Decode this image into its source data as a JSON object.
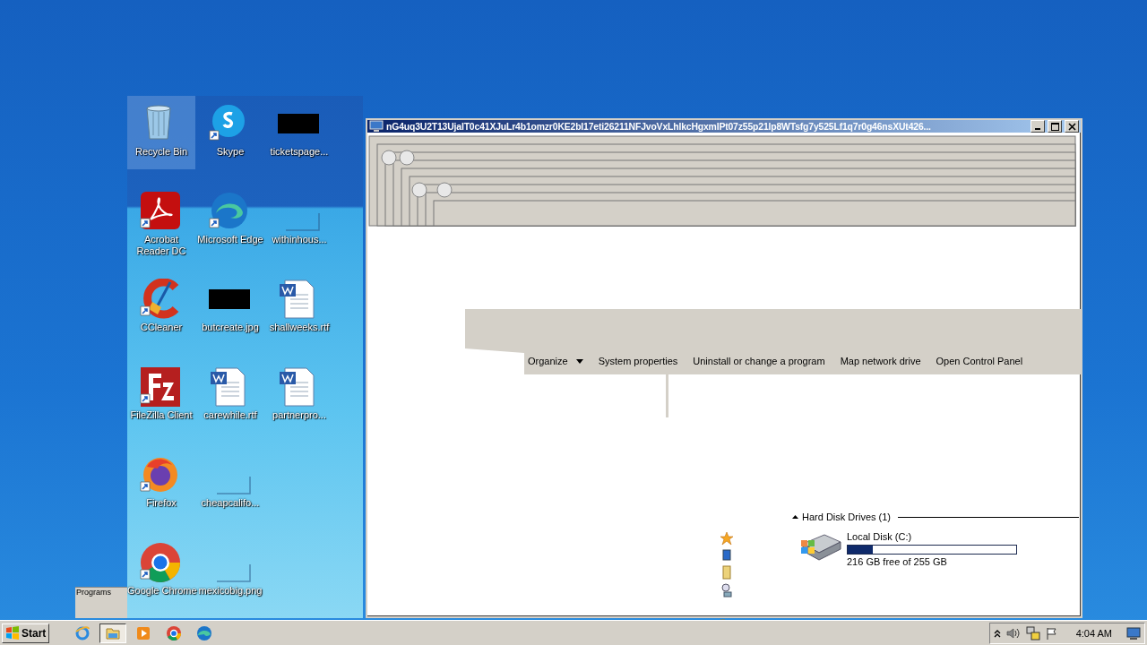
{
  "desktop_icons": [
    {
      "label": "Recycle Bin",
      "kind": "trash",
      "shortcut": false,
      "selected": true
    },
    {
      "label": "Skype",
      "kind": "chat",
      "shortcut": true,
      "selected": false
    },
    {
      "label": "ticketspage...",
      "kind": "redacted",
      "shortcut": false,
      "selected": false
    },
    {
      "label": "Acrobat Reader DC",
      "kind": "pdf",
      "shortcut": true,
      "selected": false
    },
    {
      "label": "Microsoft Edge",
      "kind": "edge",
      "shortcut": true,
      "selected": false
    },
    {
      "label": "withinhous...",
      "kind": "blank",
      "shortcut": false,
      "selected": false
    },
    {
      "label": "CCleaner",
      "kind": "broom",
      "shortcut": true,
      "selected": false
    },
    {
      "label": "butcreate.jpg",
      "kind": "redacted",
      "shortcut": false,
      "selected": false
    },
    {
      "label": "shallweeks.rtf",
      "kind": "document",
      "shortcut": false,
      "selected": false
    },
    {
      "label": "FileZilla Client",
      "kind": "filezilla",
      "shortcut": true,
      "selected": false
    },
    {
      "label": "carewhile.rtf",
      "kind": "document",
      "shortcut": false,
      "selected": false
    },
    {
      "label": "partnerpro...",
      "kind": "document",
      "shortcut": false,
      "selected": false
    },
    {
      "label": "Firefox",
      "kind": "firefox",
      "shortcut": true,
      "selected": false
    },
    {
      "label": "cheapcalifo...",
      "kind": "blank",
      "shortcut": false,
      "selected": false
    },
    {
      "kind": "empty"
    },
    {
      "label": "Google Chrome",
      "kind": "chrome",
      "shortcut": true,
      "selected": false
    },
    {
      "label": "mexicobig.png",
      "kind": "blank",
      "shortcut": false,
      "selected": false
    }
  ],
  "desktop_fragment": "Programs",
  "window": {
    "title": "nG4uq3U2T13UjaIT0c41XJuLr4b1omzr0KE2bI17eti26211NFJvoVxLhIkcHgxmIPt07z55p21lp8WTsfg7y525Lf1q7r0g46nsXUt426...",
    "toolbar": [
      {
        "label": "Organize",
        "kind": "menu"
      },
      {
        "label": "System properties",
        "kind": "button"
      },
      {
        "label": "Uninstall or change a program",
        "kind": "button"
      },
      {
        "label": "Map network drive",
        "kind": "button"
      },
      {
        "label": "Open Control Panel",
        "kind": "button"
      }
    ],
    "section": {
      "label": "Hard Disk Drives (1)",
      "expanded": true
    },
    "drives": [
      {
        "name": "Local Disk (C:)",
        "level": 0.15,
        "reading": "216 GB free of 255 GB"
      }
    ]
  },
  "taskbar": {
    "start": "Start",
    "items": [
      {
        "kind": "ie",
        "selected": false
      },
      {
        "kind": "explorer",
        "selected": true
      },
      {
        "kind": "media",
        "selected": false
      },
      {
        "kind": "chrome",
        "selected": false
      },
      {
        "kind": "edge",
        "selected": false
      }
    ],
    "clock": "4:04 AM"
  }
}
